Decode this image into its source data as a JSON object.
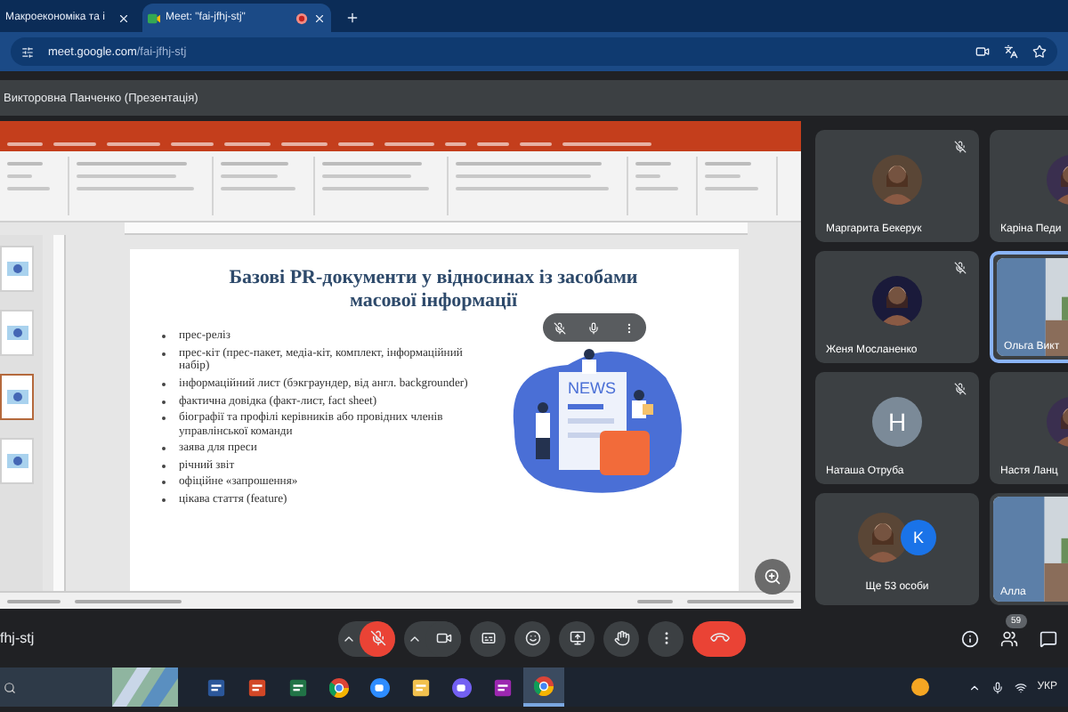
{
  "browser": {
    "tabs": [
      {
        "title": "Макроекономіка та і",
        "selected": false
      },
      {
        "title": "Meet: \"fai-jfhj-stj\"",
        "selected": true,
        "recording": true
      }
    ],
    "url_host": "meet.google.com",
    "url_path": "/fai-jfhj-stj"
  },
  "presenter_label": "Викторовна Панченко (Презентація)",
  "presentation": {
    "thumbnails": [
      {
        "selected": false
      },
      {
        "selected": false
      },
      {
        "selected": true
      },
      {
        "selected": false
      }
    ],
    "slide": {
      "title": "Базові PR-документи у відносинах із засобами масової інформації",
      "illustration_text": "NEWS",
      "bullets": [
        "прес-реліз",
        "прес-кіт (прес-пакет, медіа-кіт, комплект, інформаційний набір)",
        "інформаційний лист (бэкграундер, від англ. backgrounder)",
        "фактична довідка (факт-лист, fact sheet)",
        "біографії та профілі керівників або провідних членів управлінської команди",
        "заява для преси",
        "річний звіт",
        "офіційне «запрошення»",
        "цікава стаття (feature)"
      ]
    }
  },
  "participants": [
    {
      "name": "Маргарита Бекерук",
      "muted": true,
      "highlighted": false
    },
    {
      "name": "Каріна Педи",
      "muted": false,
      "highlighted": false
    },
    {
      "name": "Женя Мосланенко",
      "muted": true,
      "highlighted": false
    },
    {
      "name": "Ольга Викт",
      "kind": "video",
      "muted": false,
      "highlighted": true
    },
    {
      "name": "Наташа Отруба",
      "kind": "initial",
      "initial": "Н",
      "muted": true,
      "highlighted": false
    },
    {
      "name": "Настя Ланц",
      "muted": false,
      "highlighted": false
    },
    {
      "name": "Ще 53 особи",
      "kind": "more",
      "initial": "K",
      "muted": false,
      "highlighted": false
    },
    {
      "name": "Алла",
      "kind": "video",
      "muted": false,
      "highlighted": false
    }
  ],
  "meeting_code": "fhj-stj",
  "microphone": {
    "muted": true
  },
  "people_count": "59",
  "taskbar": {
    "apps": [
      {
        "kind": "document",
        "active": false
      },
      {
        "kind": "presentation",
        "active": false
      },
      {
        "kind": "spreadsheet",
        "active": false
      },
      {
        "kind": "browser",
        "active": false
      },
      {
        "kind": "video",
        "active": false
      },
      {
        "kind": "folder",
        "active": false
      },
      {
        "kind": "chat",
        "active": false
      },
      {
        "kind": "ide",
        "active": false
      },
      {
        "kind": "browser",
        "active": true
      }
    ],
    "language": "УКР"
  }
}
